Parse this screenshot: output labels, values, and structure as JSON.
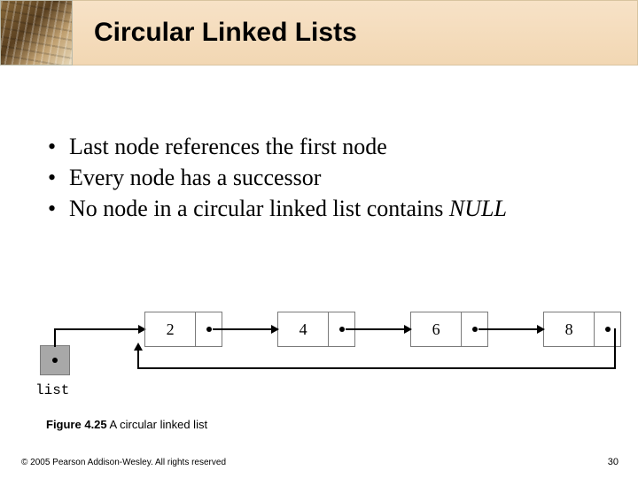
{
  "header": {
    "title": "Circular Linked Lists"
  },
  "bullets": [
    "Last node references the first node",
    "Every node has a successor",
    "No node in a circular linked list contains"
  ],
  "null_word": "NULL",
  "figure": {
    "nodes": [
      "2",
      "4",
      "6",
      "8"
    ],
    "list_label": "list"
  },
  "caption": {
    "bold": "Figure 4.25",
    "rest": "  A circular linked list"
  },
  "footer": "© 2005 Pearson Addison-Wesley. All rights reserved",
  "page": "30"
}
